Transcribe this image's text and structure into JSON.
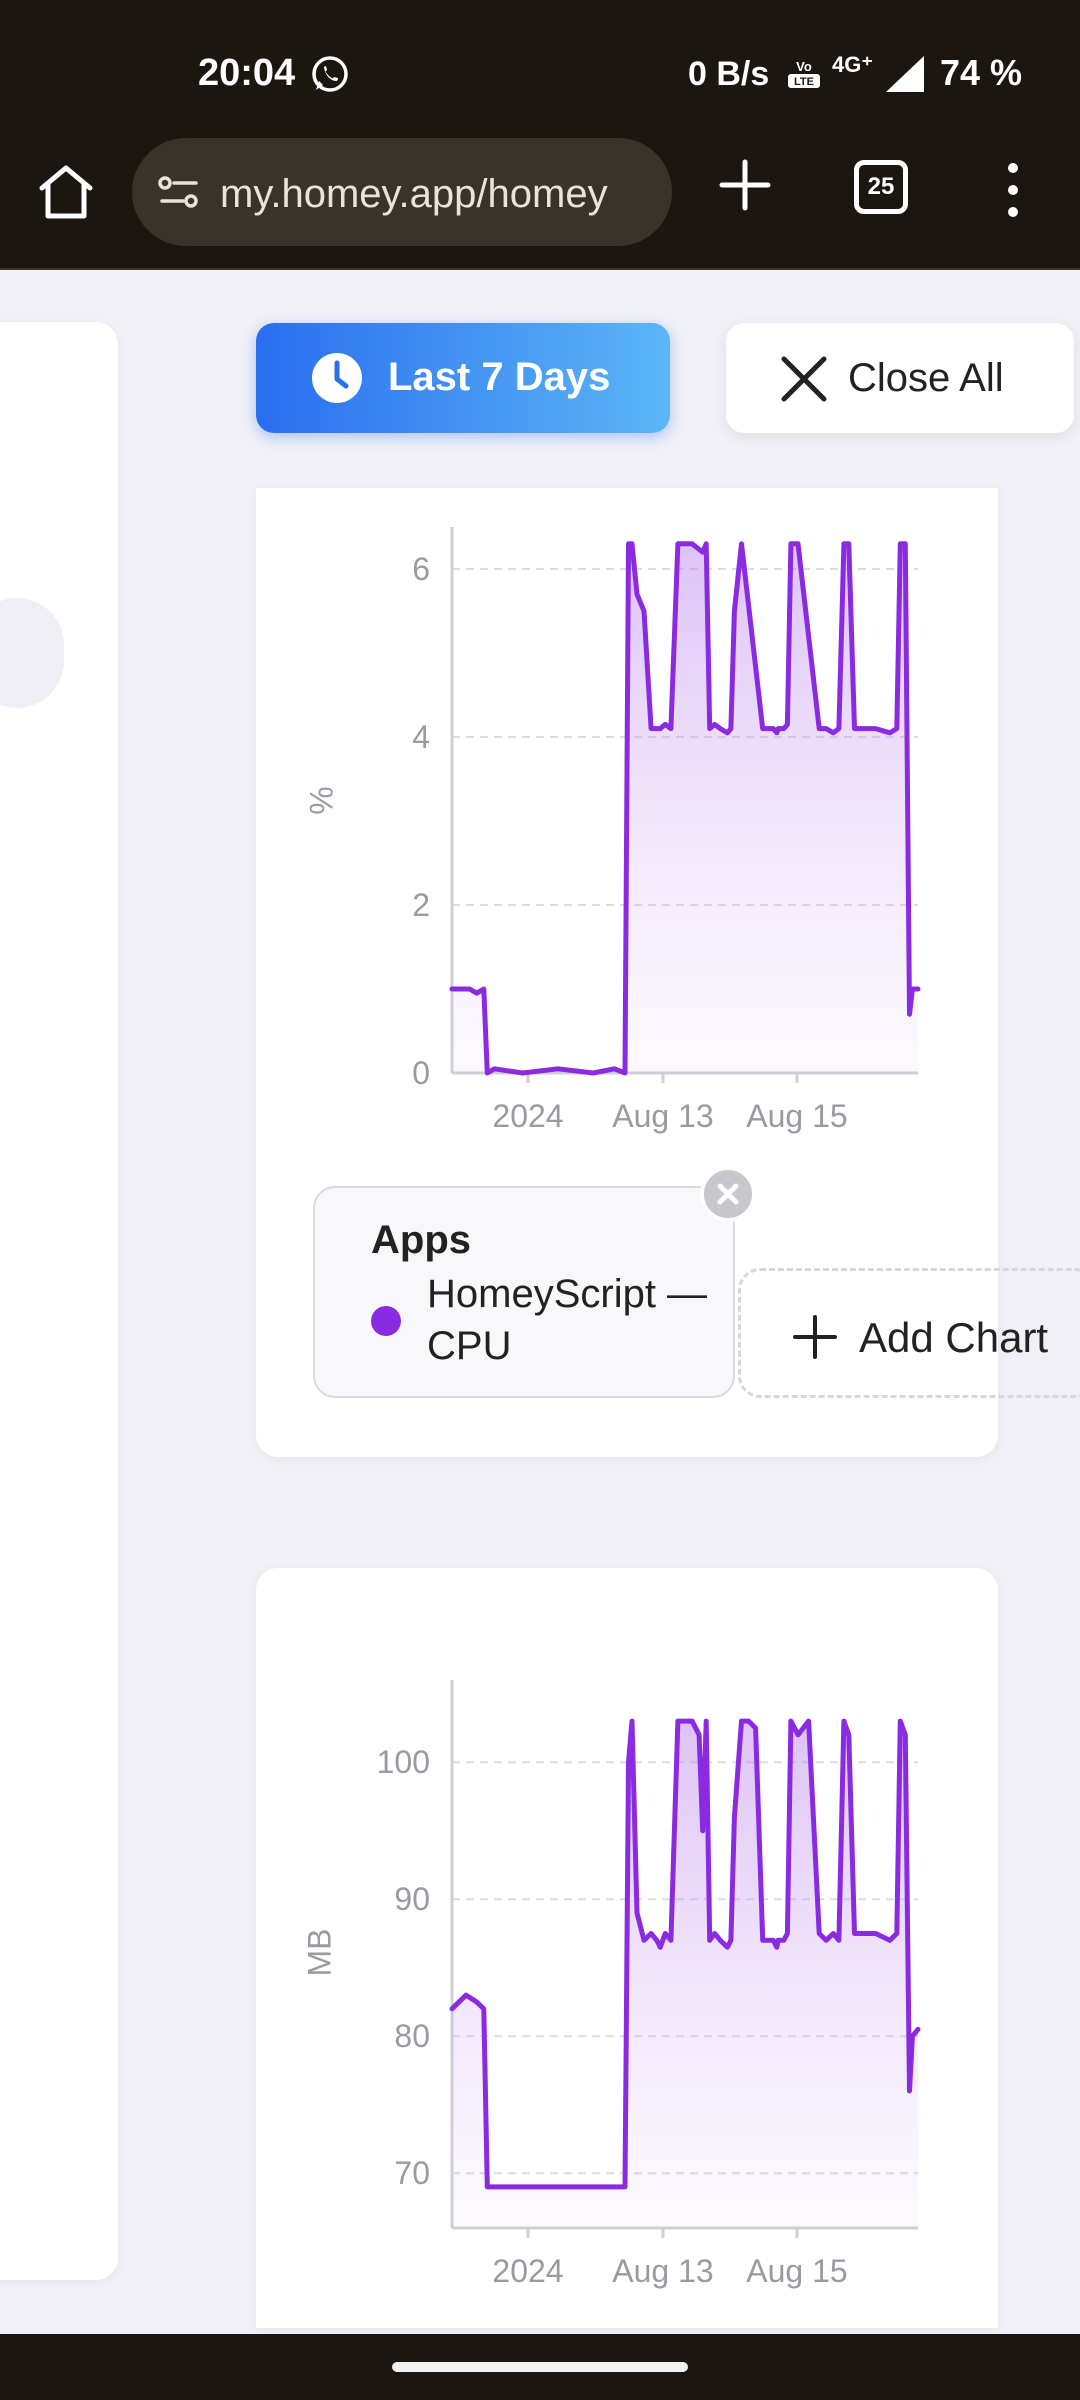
{
  "status_bar": {
    "time": "20:04",
    "network_speed": "0 B/s",
    "network_type": "4G⁺",
    "battery": "74 %",
    "icons": [
      "whatsapp-icon",
      "volte-icon",
      "signal-icon"
    ]
  },
  "browser": {
    "url": "my.homey.app/homey",
    "tab_count": "25",
    "icons": [
      "home-icon",
      "site-settings-icon",
      "new-tab-icon",
      "menu-icon"
    ]
  },
  "toolbar": {
    "range_label": "Last 7 Days",
    "close_all_label": "Close All",
    "accent_gradient": [
      "#2a6ef0",
      "#5cb6f6"
    ]
  },
  "legend": {
    "group": "Apps",
    "series_label": "HomeyScript — CPU",
    "series_color": "#8a2be2"
  },
  "add_chart_label": "Add Chart",
  "chart_data": [
    {
      "type": "area",
      "ylabel": "%",
      "ylim": [
        0,
        6.5
      ],
      "yticks": [
        "0",
        "2",
        "4",
        "6"
      ],
      "xticks": [
        "2024",
        "Aug 13",
        "Aug 15"
      ],
      "grid": true,
      "series": [
        {
          "color": "#8a2be2",
          "x": [
            0,
            0.25,
            0.35,
            0.45,
            0.5,
            0.6,
            1.0,
            1.5,
            2.0,
            2.3,
            2.45,
            2.5,
            2.55,
            2.62,
            2.72,
            2.82,
            2.9,
            2.95,
            3.02,
            3.1,
            3.2,
            3.4,
            3.55,
            3.6,
            3.65,
            3.72,
            3.8,
            3.9,
            3.95,
            4.0,
            4.1,
            4.4,
            4.55,
            4.6,
            4.62,
            4.7,
            4.75,
            4.8,
            4.9,
            5.2,
            5.3,
            5.4,
            5.48,
            5.55,
            5.62,
            5.7,
            6.0,
            6.2,
            6.3,
            6.35,
            6.42,
            6.48,
            6.52,
            6.6
          ],
          "y": [
            1.0,
            1.0,
            0.95,
            1.0,
            0.0,
            0.05,
            0.0,
            0.05,
            0.0,
            0.05,
            0.0,
            6.3,
            6.3,
            5.7,
            5.5,
            4.1,
            4.1,
            4.1,
            4.15,
            4.1,
            6.3,
            6.3,
            6.2,
            6.3,
            4.1,
            4.15,
            4.1,
            4.05,
            4.1,
            5.5,
            6.3,
            4.1,
            4.1,
            4.05,
            4.1,
            4.1,
            4.15,
            6.3,
            6.3,
            4.1,
            4.1,
            4.05,
            4.1,
            6.3,
            6.3,
            4.1,
            4.1,
            4.05,
            4.1,
            6.3,
            6.3,
            0.7,
            1.0,
            1.0
          ]
        }
      ]
    },
    {
      "type": "area",
      "ylabel": "MB",
      "ylim": [
        66,
        106
      ],
      "yticks": [
        "70",
        "80",
        "90",
        "100"
      ],
      "xticks": [
        "2024",
        "Aug 13",
        "Aug 15"
      ],
      "grid": true,
      "series": [
        {
          "color": "#8a2be2",
          "x": [
            0,
            0.2,
            0.35,
            0.45,
            0.5,
            0.6,
            1.0,
            1.5,
            2.0,
            2.3,
            2.45,
            2.5,
            2.55,
            2.62,
            2.72,
            2.82,
            2.9,
            2.95,
            3.02,
            3.1,
            3.2,
            3.4,
            3.5,
            3.55,
            3.6,
            3.65,
            3.72,
            3.8,
            3.9,
            3.95,
            4.0,
            4.1,
            4.2,
            4.3,
            4.4,
            4.55,
            4.6,
            4.62,
            4.7,
            4.75,
            4.8,
            4.9,
            5.05,
            5.2,
            5.3,
            5.4,
            5.48,
            5.55,
            5.62,
            5.7,
            6.0,
            6.2,
            6.3,
            6.35,
            6.42,
            6.48,
            6.52,
            6.6
          ],
          "y": [
            82.0,
            83.0,
            82.5,
            82.0,
            69.0,
            69.0,
            69.0,
            69.0,
            69.0,
            69.0,
            69.0,
            100.0,
            103.0,
            89.0,
            87.0,
            87.5,
            87.0,
            86.5,
            87.5,
            87.0,
            103.0,
            103.0,
            102.0,
            95.0,
            103.0,
            87.0,
            87.5,
            87.0,
            86.5,
            87.0,
            96.0,
            103.0,
            103.0,
            102.5,
            87.0,
            87.0,
            86.5,
            87.0,
            87.0,
            87.5,
            103.0,
            102.0,
            103.0,
            87.5,
            87.0,
            87.5,
            87.0,
            103.0,
            102.0,
            87.5,
            87.5,
            87.0,
            87.5,
            103.0,
            102.0,
            76.0,
            80.0,
            80.5
          ]
        }
      ]
    }
  ]
}
